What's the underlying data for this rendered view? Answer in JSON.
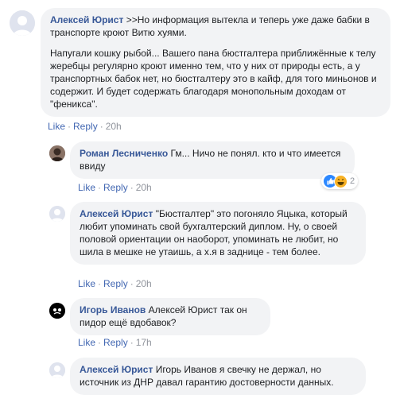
{
  "comments": [
    {
      "author": "Алексей Юрист",
      "paragraphs": [
        ">>Но информация вытекла и теперь уже даже бабки в транспорте кроют Витю хуями.",
        "Напугали кошку рыбой... Вашего пана бюстгалтера приближённые к телу жеребцы регулярно кроют именно тем, что у них от природы есть, а у транспортных бабок нет, но бюстгалтеру это в кайф, для того миньонов и содержит. И будет содержать благодаря монопольным доходам от \"феникса\"."
      ],
      "actions": {
        "like": "Like",
        "reply": "Reply",
        "time": "20h"
      }
    },
    {
      "author": "Роман Лесниченко",
      "text": "Гм... Ничо не понял. кто и что имеется ввиду",
      "actions": {
        "like": "Like",
        "reply": "Reply",
        "time": "20h"
      },
      "reactions": {
        "count": "2",
        "types": [
          "like-icon",
          "haha-icon"
        ]
      }
    },
    {
      "author": "Алексей Юрист",
      "text": "\"Бюстгалтер\" это погоняло Яцыка, который любит упоминать свой бухгалтерский диплом. Ну, о своей половой ориентации он наоборот, упоминать не любит, но шила в мешке не утаишь, а х.я в заднице - тем более.",
      "actions": {
        "like": "Like",
        "reply": "Reply",
        "time": "20h"
      }
    },
    {
      "author": "Игорь Иванов",
      "text": "Алексей Юрист так он пидор ещё вдобавок?",
      "actions": {
        "like": "Like",
        "reply": "Reply",
        "time": "17h"
      }
    },
    {
      "author": "Алексей Юрист",
      "text": "Игорь Иванов я свечку не держал, но источник из ДНР давал гарантию достоверности данных.",
      "actions": {
        "like": "Like",
        "reply": "Reply",
        "time": "17h"
      }
    }
  ],
  "colors": {
    "author": "#385898",
    "link": "#4267b2",
    "bubble": "#f2f3f5",
    "meta": "#90949c"
  }
}
